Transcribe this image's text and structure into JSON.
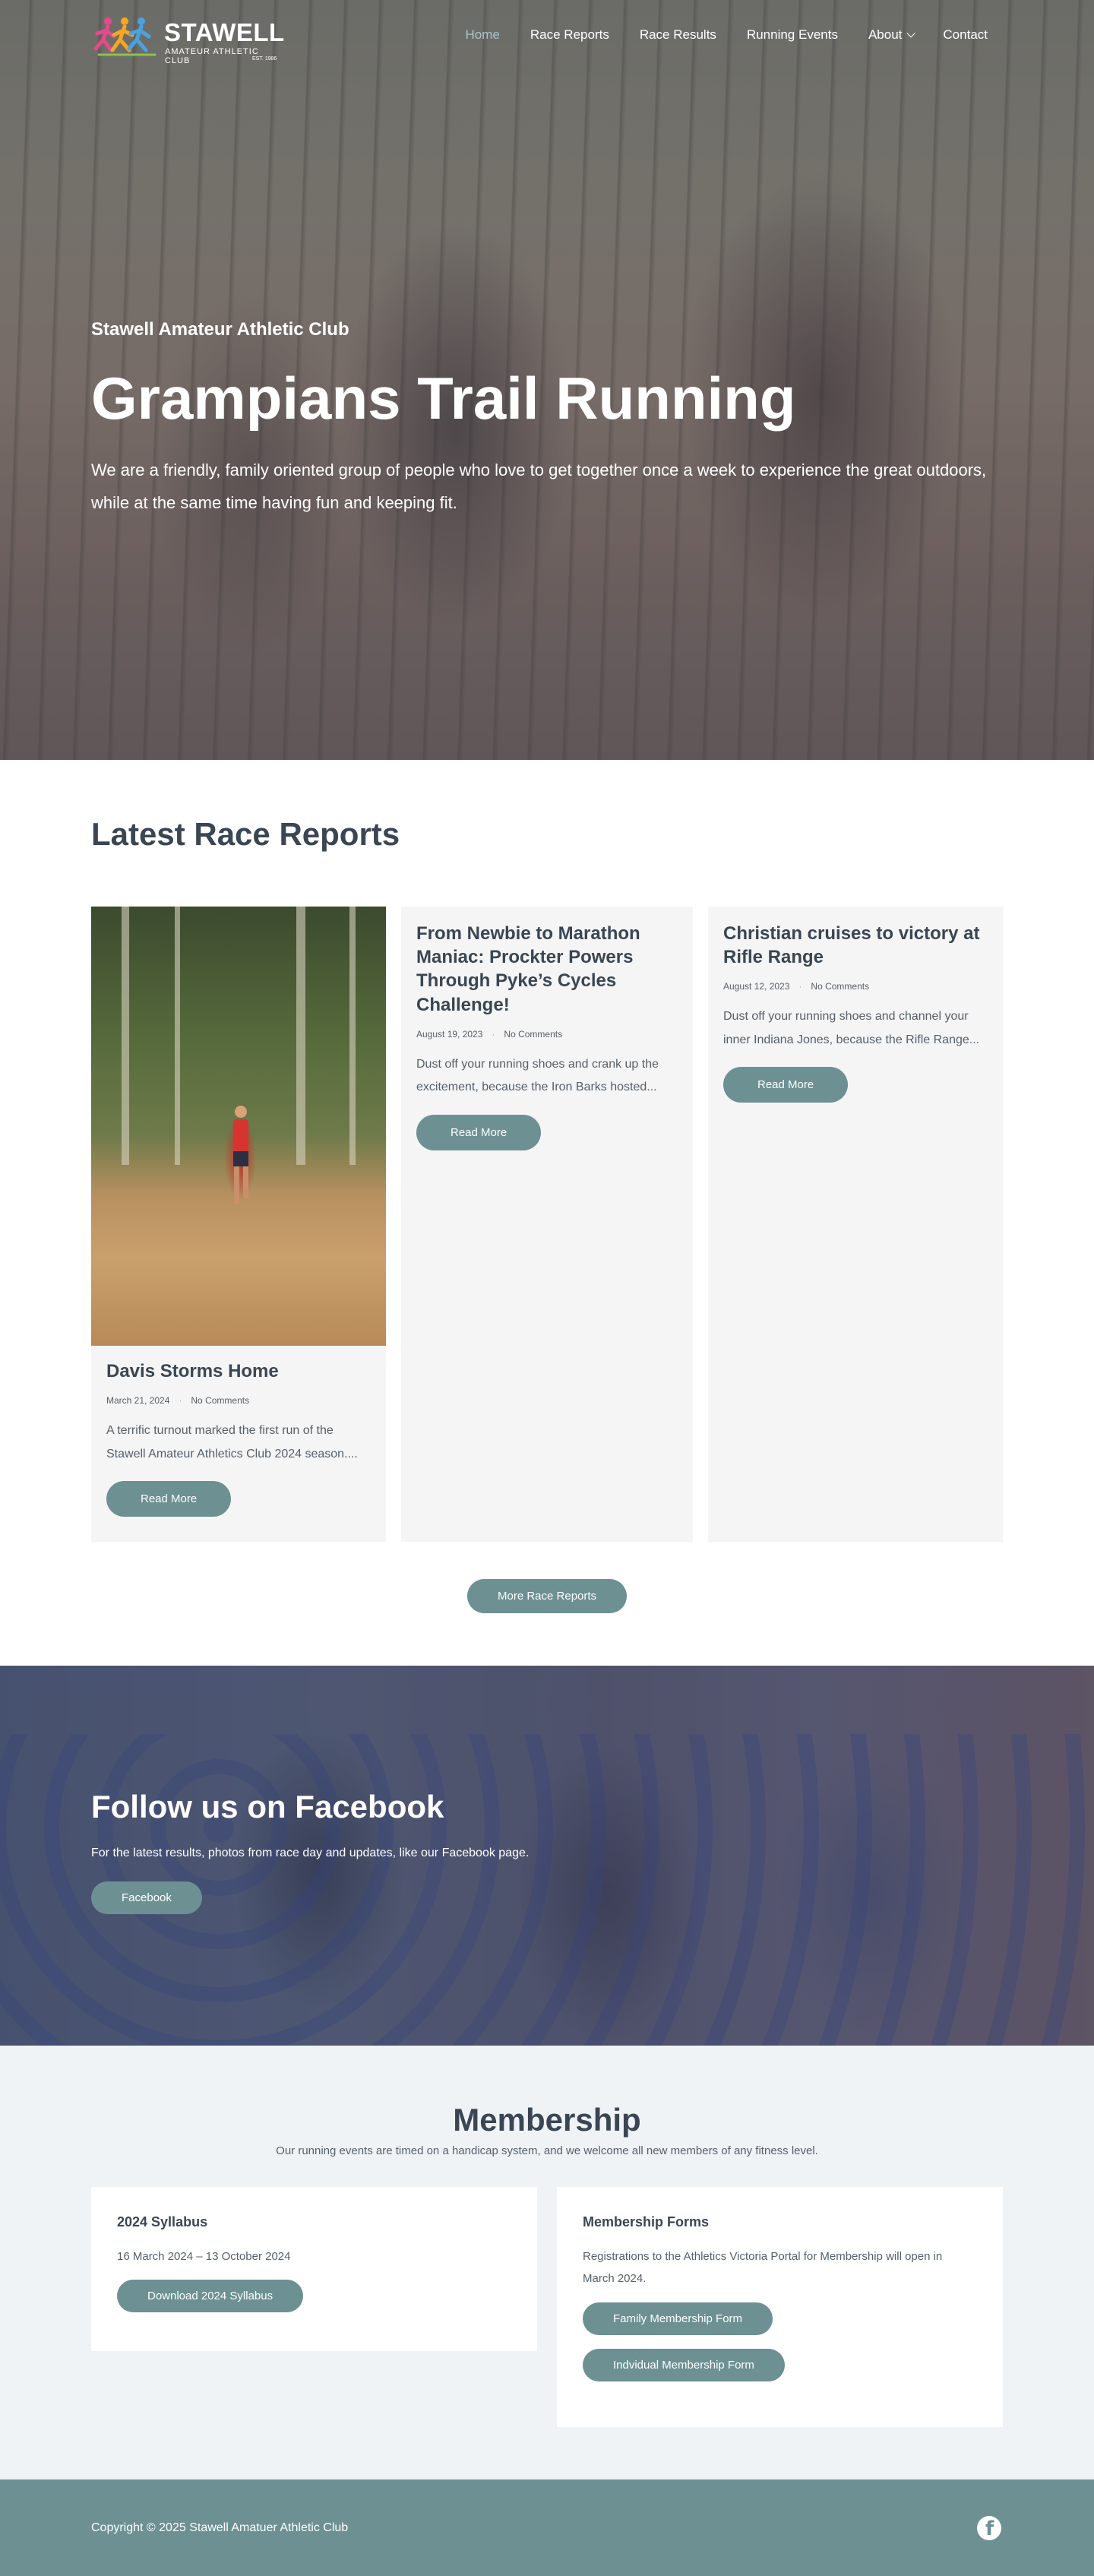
{
  "brand": {
    "title": "STAWELL",
    "subtitle": "AMATEUR ATHLETIC CLUB",
    "est": "EST. 1986"
  },
  "nav": {
    "items": [
      {
        "label": "Home",
        "active": true
      },
      {
        "label": "Race Reports"
      },
      {
        "label": "Race Results"
      },
      {
        "label": "Running Events"
      },
      {
        "label": "About",
        "has_dropdown": true
      },
      {
        "label": "Contact"
      }
    ]
  },
  "hero": {
    "subtitle": "Stawell Amateur Athletic Club",
    "title": "Grampians Trail Running",
    "description": "We are a friendly, family oriented group of people who love to get together once a week to experience the great outdoors, while at the same time having fun and keeping fit."
  },
  "reports": {
    "title": "Latest Race Reports",
    "read_more_label": "Read More",
    "more_label": "More Race Reports",
    "cards": [
      {
        "title": "Davis Storms Home",
        "date": "March 21, 2024",
        "comments": "No Comments",
        "excerpt": "A terrific turnout marked the first run of the Stawell Amateur Athletics Club 2024 season....",
        "has_image": true
      },
      {
        "title": "From Newbie to Marathon Maniac: Prockter Powers Through Pyke’s Cycles Challenge!",
        "date": "August 19, 2023",
        "comments": "No Comments",
        "excerpt": "Dust off your running shoes and crank up the excitement, because the Iron Barks hosted..."
      },
      {
        "title": "Christian cruises to victory at Rifle Range",
        "date": "August 12, 2023",
        "comments": "No Comments",
        "excerpt": "Dust off your running shoes and channel your inner Indiana Jones, because the Rifle Range..."
      }
    ]
  },
  "facebook": {
    "title": "Follow us on Facebook",
    "text": "For the latest results, photos from race day and updates, like our Facebook page.",
    "button": "Facebook"
  },
  "membership": {
    "title": "Membership",
    "description": "Our running events are timed on a handicap system, and we welcome all new members of any fitness level.",
    "syllabus": {
      "title": "2024 Syllabus",
      "dates": "16 March 2024 – 13 October 2024",
      "button": "Download 2024 Syllabus"
    },
    "forms": {
      "title": "Membership Forms",
      "text": "Registrations to the Athletics Victoria Portal for Membership will open in March 2024.",
      "family_button": "Family Membership Form",
      "individual_button": "Indvidual Membership Form"
    }
  },
  "footer": {
    "copyright": "Copyright © 2025 Stawell Amatuer Athletic Club",
    "social_icon": "facebook-icon"
  },
  "colors": {
    "accent": "#6d9093",
    "nav_active": "#a9c3cc",
    "heading": "#3a4653",
    "membership_bg": "#f0f3f6"
  }
}
